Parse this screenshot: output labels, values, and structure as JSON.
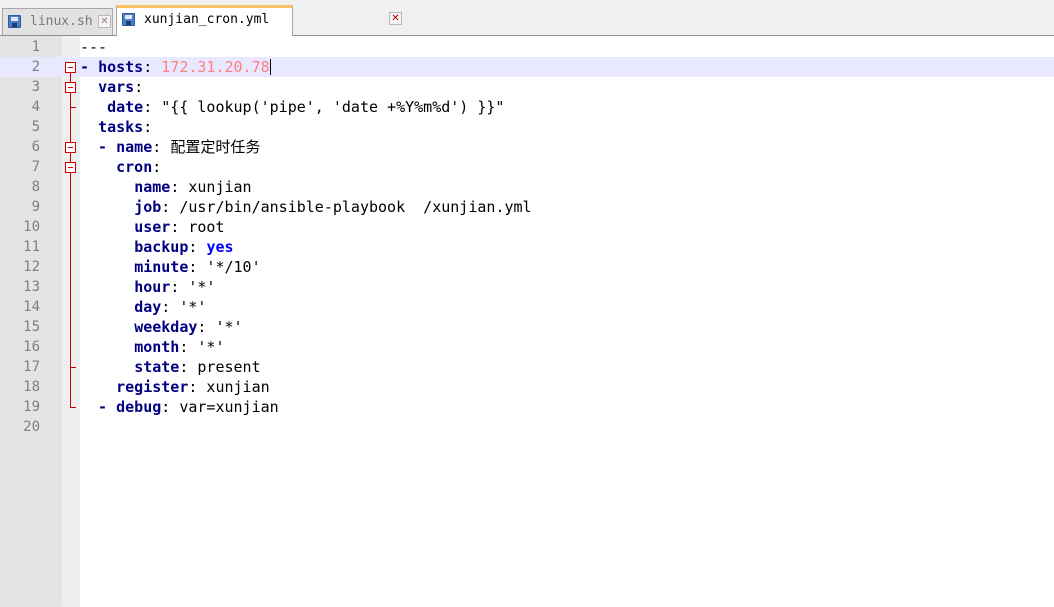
{
  "tabs": [
    {
      "label": "linux.sh",
      "active": false
    },
    {
      "label": "xunjian_cron.yml",
      "active": true
    }
  ],
  "editor": {
    "current_line": 2,
    "lines": [
      {
        "n": "1",
        "parts": [
          {
            "t": "---",
            "c": "val"
          }
        ]
      },
      {
        "n": "2",
        "parts": [
          {
            "t": "- ",
            "c": "dash"
          },
          {
            "t": "hosts",
            "c": "key"
          },
          {
            "t": ": ",
            "c": "val"
          },
          {
            "t": "172.31.20.78",
            "c": "ip"
          }
        ]
      },
      {
        "n": "3",
        "parts": [
          {
            "t": "  ",
            "c": "val"
          },
          {
            "t": "vars",
            "c": "key"
          },
          {
            "t": ":",
            "c": "val"
          }
        ]
      },
      {
        "n": "4",
        "parts": [
          {
            "t": "   ",
            "c": "val"
          },
          {
            "t": "date",
            "c": "key"
          },
          {
            "t": ": \"{{ lookup('pipe', 'date +%Y%m%d') }}\"",
            "c": "val"
          }
        ]
      },
      {
        "n": "5",
        "parts": [
          {
            "t": "  ",
            "c": "val"
          },
          {
            "t": "tasks",
            "c": "key"
          },
          {
            "t": ":",
            "c": "val"
          }
        ]
      },
      {
        "n": "6",
        "parts": [
          {
            "t": "  - ",
            "c": "dash"
          },
          {
            "t": "name",
            "c": "key"
          },
          {
            "t": ": ",
            "c": "val"
          },
          {
            "t": "配置定时任务",
            "c": "cjk"
          }
        ]
      },
      {
        "n": "7",
        "parts": [
          {
            "t": "    ",
            "c": "val"
          },
          {
            "t": "cron",
            "c": "key"
          },
          {
            "t": ":",
            "c": "val"
          }
        ]
      },
      {
        "n": "8",
        "parts": [
          {
            "t": "      ",
            "c": "val"
          },
          {
            "t": "name",
            "c": "key"
          },
          {
            "t": ": xunjian",
            "c": "val"
          }
        ]
      },
      {
        "n": "9",
        "parts": [
          {
            "t": "      ",
            "c": "val"
          },
          {
            "t": "job",
            "c": "key"
          },
          {
            "t": ": /usr/bin/ansible-playbook  /xunjian.yml",
            "c": "val"
          }
        ]
      },
      {
        "n": "10",
        "parts": [
          {
            "t": "      ",
            "c": "val"
          },
          {
            "t": "user",
            "c": "key"
          },
          {
            "t": ": root",
            "c": "val"
          }
        ]
      },
      {
        "n": "11",
        "parts": [
          {
            "t": "      ",
            "c": "val"
          },
          {
            "t": "backup",
            "c": "key"
          },
          {
            "t": ": ",
            "c": "val"
          },
          {
            "t": "yes",
            "c": "bool"
          }
        ]
      },
      {
        "n": "12",
        "parts": [
          {
            "t": "      ",
            "c": "val"
          },
          {
            "t": "minute",
            "c": "key"
          },
          {
            "t": ": '*/10'",
            "c": "val"
          }
        ]
      },
      {
        "n": "13",
        "parts": [
          {
            "t": "      ",
            "c": "val"
          },
          {
            "t": "hour",
            "c": "key"
          },
          {
            "t": ": '*'",
            "c": "val"
          }
        ]
      },
      {
        "n": "14",
        "parts": [
          {
            "t": "      ",
            "c": "val"
          },
          {
            "t": "day",
            "c": "key"
          },
          {
            "t": ": '*'",
            "c": "val"
          }
        ]
      },
      {
        "n": "15",
        "parts": [
          {
            "t": "      ",
            "c": "val"
          },
          {
            "t": "weekday",
            "c": "key"
          },
          {
            "t": ": '*'",
            "c": "val"
          }
        ]
      },
      {
        "n": "16",
        "parts": [
          {
            "t": "      ",
            "c": "val"
          },
          {
            "t": "month",
            "c": "key"
          },
          {
            "t": ": '*'",
            "c": "val"
          }
        ]
      },
      {
        "n": "17",
        "parts": [
          {
            "t": "      ",
            "c": "val"
          },
          {
            "t": "state",
            "c": "key"
          },
          {
            "t": ": present",
            "c": "val"
          }
        ]
      },
      {
        "n": "18",
        "parts": [
          {
            "t": "    ",
            "c": "val"
          },
          {
            "t": "register",
            "c": "key"
          },
          {
            "t": ": xunjian",
            "c": "val"
          }
        ]
      },
      {
        "n": "19",
        "parts": [
          {
            "t": "  - ",
            "c": "dash"
          },
          {
            "t": "debug",
            "c": "key"
          },
          {
            "t": ": var=xunjian",
            "c": "val"
          }
        ]
      },
      {
        "n": "20",
        "parts": []
      }
    ]
  },
  "fold_markers": {
    "open_lines": [
      2,
      3,
      6,
      7
    ],
    "end_lines": [
      4,
      17,
      19
    ]
  },
  "icons": {
    "tab_file": "save-icon",
    "tab_close": "close-icon"
  },
  "colors": {
    "key": "#000080",
    "ip": "#ff8080",
    "bool": "#0000ff",
    "fold": "#cc0000",
    "current_line": "#e8e8ff",
    "active_tab_accent": "#f9c163"
  }
}
